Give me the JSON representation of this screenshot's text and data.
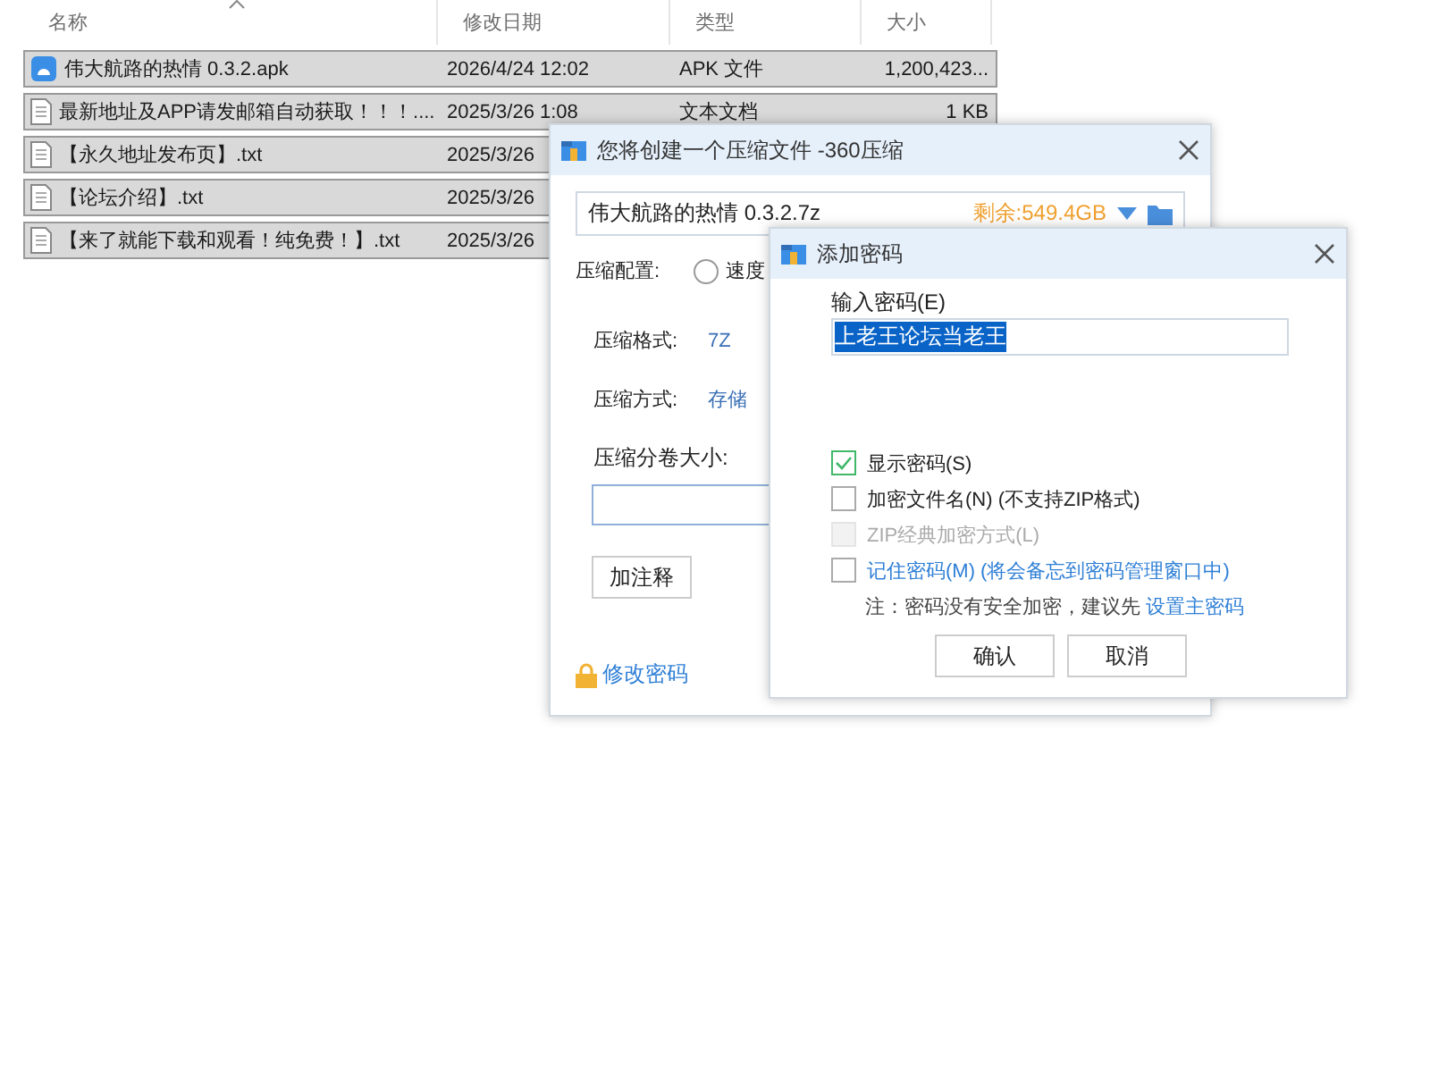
{
  "explorer": {
    "columns": [
      "名称",
      "修改日期",
      "类型",
      "大小"
    ],
    "rows": [
      {
        "kind": "apk",
        "name": "伟大航路的热情 0.3.2.apk",
        "date": "2026/4/24 12:02",
        "type": "APK 文件",
        "size": "1,200,423...",
        "selected": true
      },
      {
        "kind": "txt",
        "name": "最新地址及APP请发邮箱自动获取！！！....",
        "date": "2025/3/26 1:08",
        "type": "文本文档",
        "size": "1 KB",
        "selected": true
      },
      {
        "kind": "txt",
        "name": "【永久地址发布页】.txt",
        "date": "2025/3/26",
        "selected": true
      },
      {
        "kind": "txt",
        "name": "【论坛介绍】.txt",
        "date": "2025/3/26",
        "selected": true
      },
      {
        "kind": "txt",
        "name": "【来了就能下载和观看！纯免费！】.txt",
        "date": "2025/3/26",
        "selected": true
      }
    ]
  },
  "compress_dialog": {
    "title": "您将创建一个压缩文件 -360压缩",
    "filename": "伟大航路的热情 0.3.2.7z",
    "free_space": "剩余:549.4GB",
    "config_label": "压缩配置:",
    "config_option": {
      "label": "速度",
      "selected": false
    },
    "settings": [
      {
        "label": "压缩格式:",
        "value": "7Z"
      },
      {
        "label": "压缩方式:",
        "value": "存储"
      }
    ],
    "volume_label": "压缩分卷大小:",
    "comment_button": "加注释",
    "change_password_link": "修改密码"
  },
  "password_dialog": {
    "title": "添加密码",
    "field_label": "输入密码(E)",
    "password": "上老王论坛当老王",
    "password_highlighted": true,
    "options": [
      {
        "label": "显示密码(S)",
        "checked": true,
        "disabled": false,
        "kind": "plain"
      },
      {
        "label": "加密文件名(N) (不支持ZIP格式)",
        "checked": false,
        "disabled": false,
        "kind": "plain"
      },
      {
        "label": "ZIP经典加密方式(L)",
        "checked": false,
        "disabled": true,
        "kind": "plain"
      },
      {
        "label": "记住密码(M) (将会备忘到密码管理窗口中)",
        "checked": false,
        "disabled": false,
        "kind": "link"
      }
    ],
    "note": "注：密码没有安全加密，建议先",
    "note_link": "设置主密码",
    "buttons": [
      "确认",
      "取消"
    ]
  }
}
